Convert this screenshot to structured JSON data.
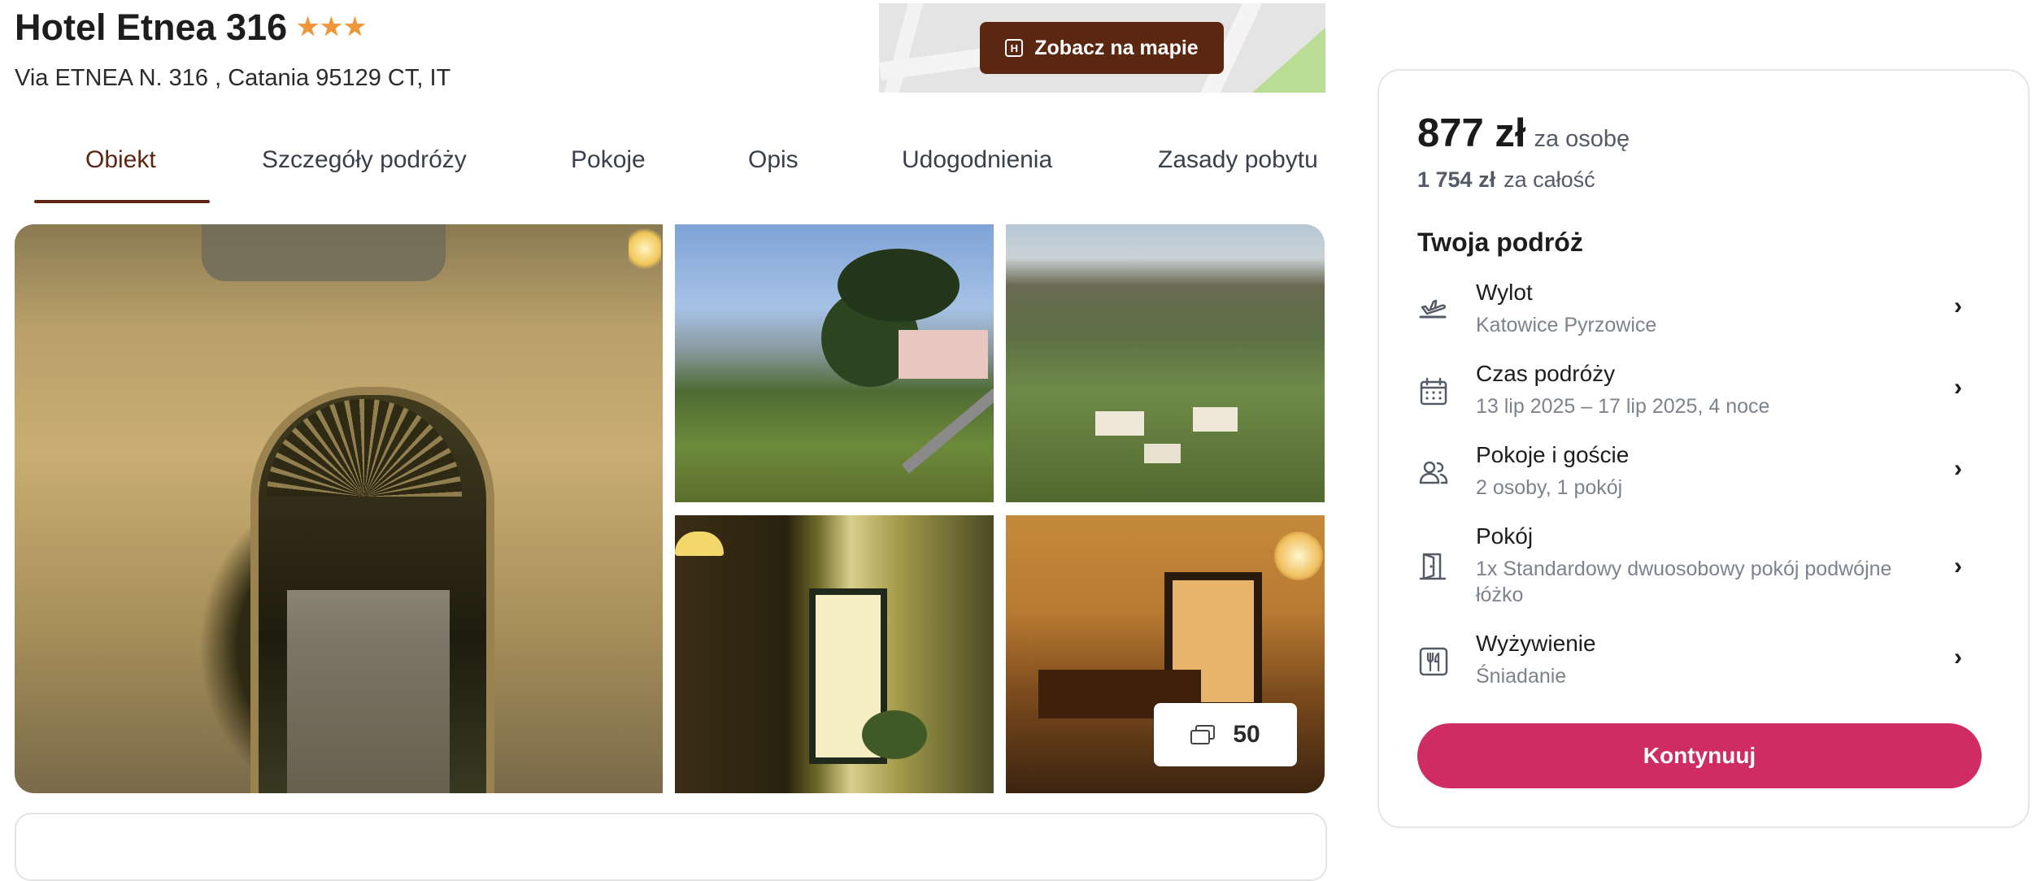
{
  "hotel": {
    "name": "Hotel Etnea 316",
    "stars": [
      "★",
      "★",
      "★"
    ],
    "address": "Via ETNEA N. 316 , Catania 95129 CT, IT"
  },
  "map": {
    "button_label": "Zobacz na mapie",
    "icon": "hotel-marker-icon"
  },
  "tabs": [
    {
      "label": "Obiekt",
      "active": true
    },
    {
      "label": "Szczegóły podróży",
      "active": false
    },
    {
      "label": "Pokoje",
      "active": false
    },
    {
      "label": "Opis",
      "active": false
    },
    {
      "label": "Udogodnienia",
      "active": false
    },
    {
      "label": "Zasady pobytu",
      "active": false
    }
  ],
  "gallery": {
    "photo_count": "50",
    "photos": [
      "hotel-entrance-photo",
      "garden-view-photo",
      "etna-valley-photo",
      "hallway-photo",
      "reception-photo"
    ]
  },
  "booking": {
    "price_per_person": "877 zł",
    "per_person_label": "za osobę",
    "price_total": "1 754 zł",
    "total_label": "za całość",
    "trip_heading": "Twoja podróż",
    "rows": [
      {
        "icon": "plane-departure-icon",
        "title": "Wylot",
        "sub": "Katowice Pyrzowice"
      },
      {
        "icon": "calendar-icon",
        "title": "Czas podróży",
        "sub": "13 lip 2025 – 17 lip 2025, 4 noce"
      },
      {
        "icon": "guests-icon",
        "title": "Pokoje i goście",
        "sub": "2 osoby, 1 pokój"
      },
      {
        "icon": "door-icon",
        "title": "Pokój",
        "sub": "1x Standardowy dwuosobowy pokój podwójne łóżko"
      },
      {
        "icon": "cutlery-icon",
        "title": "Wyżywienie",
        "sub": "Śniadanie"
      }
    ],
    "continue_label": "Kontynuuj"
  },
  "colors": {
    "brand_brown": "#5b2710",
    "cta_pink": "#cf2c63",
    "star_orange": "#f0963a"
  }
}
